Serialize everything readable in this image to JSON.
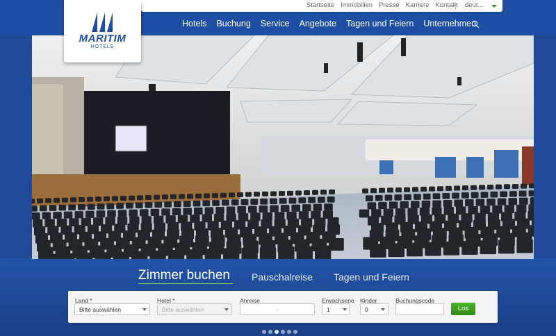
{
  "topbar": {
    "links": [
      "Startseite",
      "Immobilien",
      "Presse",
      "Karriere",
      "Kontakt"
    ],
    "language": "deut..."
  },
  "logo": {
    "word": "MARITIM",
    "sub": "HOTELS"
  },
  "nav": {
    "items": [
      "Hotels",
      "Buchung",
      "Service",
      "Angebote",
      "Tagen und Feiern",
      "Unternehmen"
    ]
  },
  "booking": {
    "tabs": [
      "Zimmer buchen",
      "Pauschalreise",
      "Tagen und Feiern"
    ],
    "active_tab": "Zimmer buchen",
    "fields": {
      "land": {
        "label": "Land *",
        "value": "Bitte auswählen"
      },
      "hotel": {
        "label": "Hotel *",
        "value": "Bitte auswählen"
      },
      "anreise": {
        "label": "Anreise",
        "value": "-"
      },
      "erwachsene": {
        "label": "Erwachsene",
        "value": "1"
      },
      "kinder": {
        "label": "Kinder",
        "value": "0"
      },
      "buchungscode": {
        "label": "Buchungscode",
        "value": ""
      }
    },
    "submit": "Los"
  },
  "slider": {
    "total": 6,
    "active": 3
  },
  "colors": {
    "brand": "#1e4ea3",
    "accent_green": "#3a9a1e"
  }
}
